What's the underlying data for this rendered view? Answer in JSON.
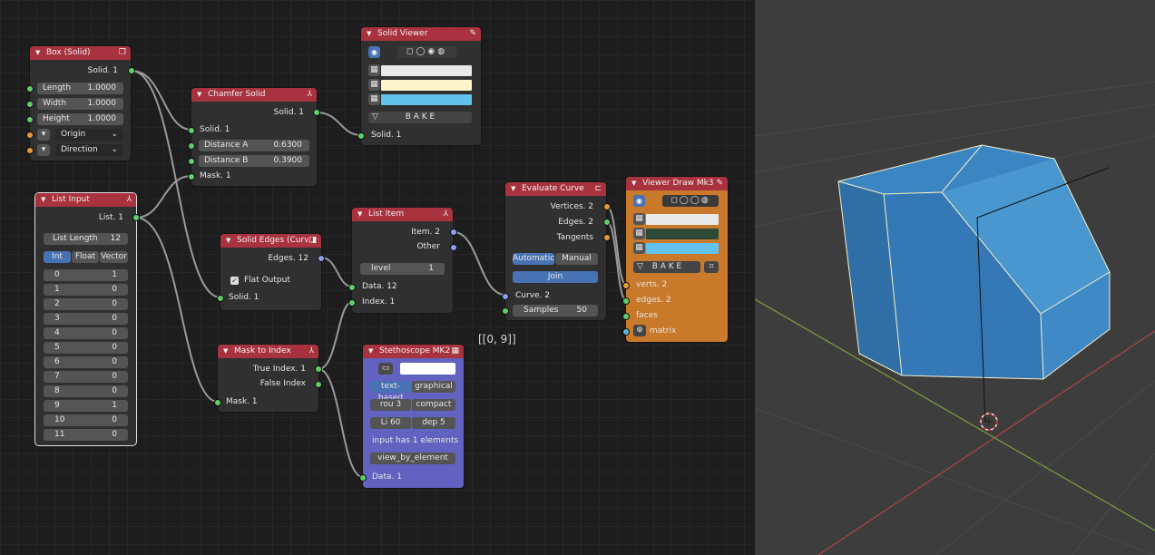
{
  "box_node": {
    "title": "Box (Solid)",
    "output": "Solid. 1",
    "fields": [
      {
        "label": "Length",
        "value": "1.0000"
      },
      {
        "label": "Width",
        "value": "1.0000"
      },
      {
        "label": "Height",
        "value": "1.0000"
      }
    ],
    "origin": "Origin",
    "direction": "Direction"
  },
  "chamfer_node": {
    "title": "Chamfer Solid",
    "output": "Solid. 1",
    "input_solid": "Solid. 1",
    "distance_a": {
      "label": "Distance A",
      "value": "0.6300"
    },
    "distance_b": {
      "label": "Distance B",
      "value": "0.3900"
    },
    "mask": "Mask. 1"
  },
  "solid_viewer": {
    "title": "Solid Viewer",
    "bake": "B A K E",
    "input": "Solid. 1",
    "colors": [
      "#e9e9e9",
      "#fff5cc",
      "#63c2ec"
    ]
  },
  "list_input": {
    "title": "List Input",
    "output": "List. 1",
    "list_length_label": "List Length",
    "list_length": "12",
    "types": [
      "Int",
      "Float",
      "Vector"
    ],
    "items": [
      {
        "i": "0",
        "v": "1"
      },
      {
        "i": "1",
        "v": "0"
      },
      {
        "i": "2",
        "v": "0"
      },
      {
        "i": "3",
        "v": "0"
      },
      {
        "i": "4",
        "v": "0"
      },
      {
        "i": "5",
        "v": "0"
      },
      {
        "i": "6",
        "v": "0"
      },
      {
        "i": "7",
        "v": "0"
      },
      {
        "i": "8",
        "v": "0"
      },
      {
        "i": "9",
        "v": "1"
      },
      {
        "i": "10",
        "v": "0"
      },
      {
        "i": "11",
        "v": "0"
      }
    ]
  },
  "solid_edges": {
    "title": "Solid Edges (Curv...",
    "output": "Edges. 12",
    "flat_output": "Flat Output",
    "input": "Solid. 1"
  },
  "list_item": {
    "title": "List Item",
    "out_item": "Item. 2",
    "out_other": "Other",
    "level_label": "level",
    "level_value": "1",
    "in_data": "Data. 12",
    "in_index": "Index. 1"
  },
  "mask_to_index": {
    "title": "Mask to Index",
    "out_true": "True Index. 1",
    "out_false": "False Index",
    "in_mask": "Mask. 1"
  },
  "evaluate_curve": {
    "title": "Evaluate Curve",
    "out_vertices": "Vertices. 2",
    "out_edges": "Edges. 2",
    "out_tangents": "Tangents",
    "mode_auto": "Automatic",
    "mode_manual": "Manual",
    "join": "Join",
    "in_curve": "Curve. 2",
    "samples_label": "Samples",
    "samples_value": "50"
  },
  "viewer_draw": {
    "title": "Viewer Draw Mk3",
    "bake": "B A K E",
    "colors": [
      "#e9e9e9",
      "#2d4a36",
      "#63c2ec"
    ],
    "inputs": [
      "verts. 2",
      "edges. 2",
      "faces",
      "matrix"
    ]
  },
  "stethoscope": {
    "title": "Stethoscope MK2",
    "mode_text": "text-based",
    "mode_graphical": "graphical",
    "rou": "rou  3",
    "compact": "compact",
    "li": "Li  60",
    "dep": "dep  5",
    "info": "input has 1 elements",
    "view_button": "view_by_element",
    "input": "Data. 1"
  },
  "annotation": "[[0, 9]]"
}
